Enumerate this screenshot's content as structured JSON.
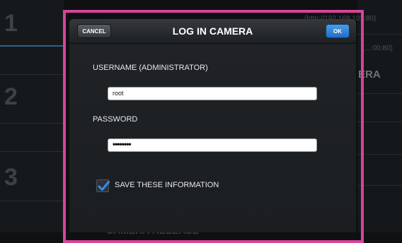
{
  "background": {
    "left_numbers": [
      "1",
      "2",
      "3"
    ],
    "right_text_1": "(http://192.168.101:80)",
    "right_text_2": "(...:00:80)",
    "right_big": "ERA",
    "bottom_text": "CAMERA RELEASE"
  },
  "dialog": {
    "title": "LOG IN CAMERA",
    "cancel_label": "CANCEL",
    "ok_label": "OK",
    "username_label": "USERNAME (ADMINISTRATOR)",
    "username_value": "root",
    "password_label": "PASSWORD",
    "password_value": "••••••••",
    "save_label": "SAVE THESE INFORMATION",
    "save_checked": true
  },
  "colors": {
    "highlight": "#d8449a",
    "ok_button": "#1e6fc8",
    "checkmark": "#2f8ff0"
  }
}
